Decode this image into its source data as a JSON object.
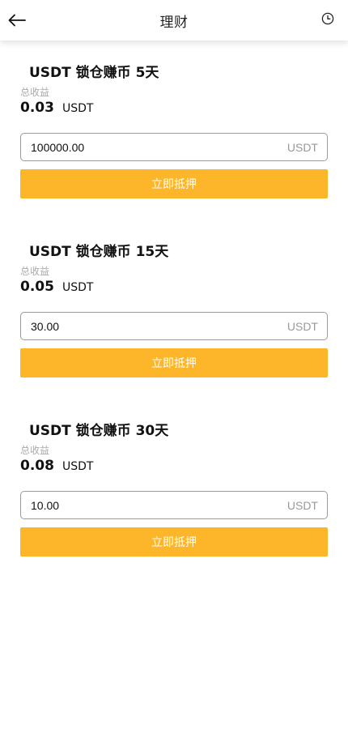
{
  "header": {
    "title": "理财",
    "back_icon": "arrow-left-icon",
    "history_icon": "clock-icon"
  },
  "products": [
    {
      "title": "USDT 锁仓赚币 5天",
      "income_label": "总收益",
      "income_value": "0.03",
      "income_unit": "USDT",
      "amount_value": "100000.00",
      "amount_unit": "USDT",
      "button_label": "立即抵押"
    },
    {
      "title": "USDT 锁仓赚币 15天",
      "income_label": "总收益",
      "income_value": "0.05",
      "income_unit": "USDT",
      "amount_value": "30.00",
      "amount_unit": "USDT",
      "button_label": "立即抵押"
    },
    {
      "title": "USDT 锁仓赚币 30天",
      "income_label": "总收益",
      "income_value": "0.08",
      "income_unit": "USDT",
      "amount_value": "10.00",
      "amount_unit": "USDT",
      "button_label": "立即抵押"
    }
  ],
  "colors": {
    "accent": "#fdb52a",
    "label_gray": "#aaaaaa",
    "unit_gray": "#999999"
  }
}
